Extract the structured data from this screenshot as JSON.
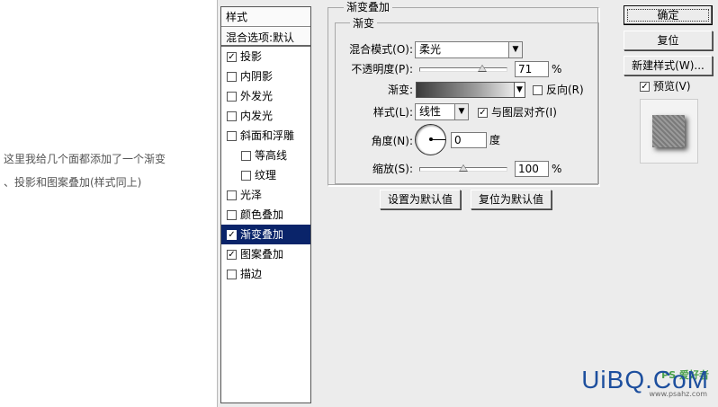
{
  "caption": {
    "line1": "这里我给几个面都添加了一个渐变",
    "line2": "、投影和图案叠加(样式同上)"
  },
  "styles_panel": {
    "title": "样式",
    "blend_options": "混合选项:默认",
    "items": [
      {
        "label": "投影",
        "checked": true
      },
      {
        "label": "内阴影",
        "checked": false
      },
      {
        "label": "外发光",
        "checked": false
      },
      {
        "label": "内发光",
        "checked": false
      },
      {
        "label": "斜面和浮雕",
        "checked": false
      },
      {
        "label": "等高线",
        "checked": false,
        "indent": true
      },
      {
        "label": "纹理",
        "checked": false,
        "indent": true
      },
      {
        "label": "光泽",
        "checked": false
      },
      {
        "label": "颜色叠加",
        "checked": false
      },
      {
        "label": "渐变叠加",
        "checked": true,
        "selected": true
      },
      {
        "label": "图案叠加",
        "checked": true
      },
      {
        "label": "描边",
        "checked": false
      }
    ]
  },
  "gradient_overlay": {
    "group_title": "渐变叠加",
    "inner_title": "渐变",
    "blend_mode_label": "混合模式(O):",
    "blend_mode_value": "柔光",
    "opacity_label": "不透明度(P):",
    "opacity_value": "71",
    "opacity_unit": "%",
    "opacity_fraction": 0.71,
    "gradient_label": "渐变:",
    "reverse_label": "反向(R)",
    "reverse_checked": false,
    "style_label": "样式(L):",
    "style_value": "线性",
    "align_label": "与图层对齐(I)",
    "align_checked": true,
    "angle_label": "角度(N):",
    "angle_value": "0",
    "angle_unit": "度",
    "scale_label": "缩放(S):",
    "scale_value": "100",
    "scale_unit": "%",
    "scale_fraction": 0.5,
    "set_default_label": "设置为默认值",
    "reset_default_label": "复位为默认值"
  },
  "right_panel": {
    "ok_label": "确定",
    "reset_label": "复位",
    "new_style_label": "新建样式(W)...",
    "preview_label": "预览(V)",
    "preview_checked": true
  },
  "watermark": {
    "main": "UiBQ.CoM",
    "side": "PS 爱好者",
    "url": "www.psahz.com"
  },
  "colors": {
    "selection": "#0a246a",
    "dialog_bg": "#ececec",
    "watermark_blue": "#1d4f9e"
  }
}
